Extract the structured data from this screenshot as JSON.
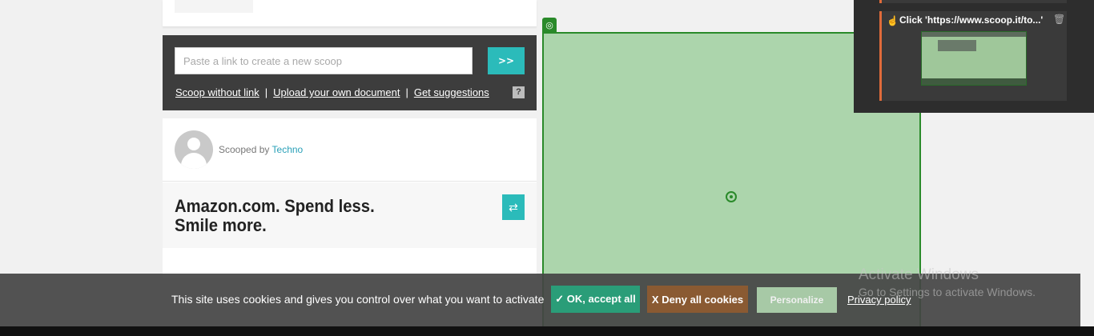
{
  "scoop_box": {
    "input_placeholder": "Paste a link to create a new scoop",
    "go_label": ">>",
    "links": {
      "without_link": "Scoop without link",
      "upload": "Upload your own document",
      "suggestions": "Get suggestions"
    },
    "separator": "|",
    "help_label": "?"
  },
  "post": {
    "scooped_by_prefix": "Scooped by",
    "author": "Techno",
    "title": "Amazon.com. Spend less. Smile more."
  },
  "overlay": {
    "color": "#73be73"
  },
  "side_panel": {
    "step_label": "Click 'https://www.scoop.it/to...'",
    "accent_color": "#e06b3a"
  },
  "cookie_bar": {
    "text": "This site uses cookies and gives you control over what you want to activate",
    "accept_label": "✓ OK, accept all",
    "deny_label": "X Deny all cookies",
    "personalize_label": "Personalize",
    "privacy_label": "Privacy policy"
  },
  "watermark": {
    "title": "Activate Windows",
    "subtitle": "Go to Settings to activate Windows."
  },
  "colors": {
    "brand_teal": "#2bbbba",
    "accept_green": "#2a9d78",
    "deny_brown": "#8a5a32"
  }
}
